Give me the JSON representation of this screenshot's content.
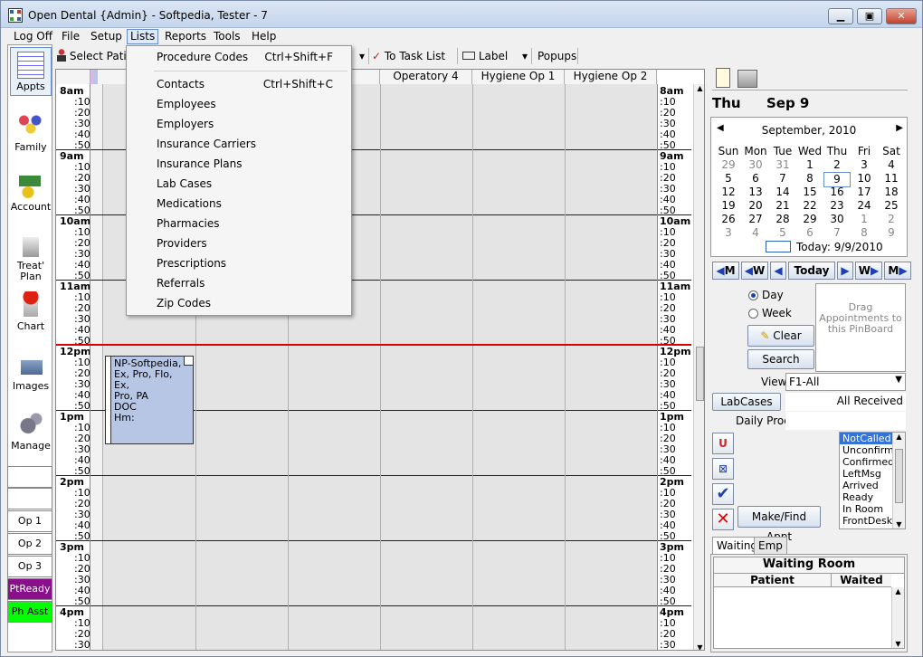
{
  "window": {
    "title": "Open Dental {Admin} - Softpedia, Tester - 7"
  },
  "menubar": {
    "items": [
      "Log Off",
      "File",
      "Setup",
      "Lists",
      "Reports",
      "Tools",
      "Help"
    ]
  },
  "toolbar": {
    "select_patient": "Select Pati",
    "task_list": "To Task List",
    "label": "Label",
    "popups": "Popups"
  },
  "nav": [
    {
      "label": "Appts",
      "icon": "appointments-icon"
    },
    {
      "label": "Family",
      "icon": "family-icon"
    },
    {
      "label": "Account",
      "icon": "account-icon"
    },
    {
      "label": "Treat' Plan",
      "icon": "treatment-plan-icon"
    },
    {
      "label": "Chart",
      "icon": "chart-tooth-icon"
    },
    {
      "label": "Images",
      "icon": "images-icon"
    },
    {
      "label": "Manage",
      "icon": "manage-gears-icon"
    }
  ],
  "providers": [
    "Op 1",
    "Op 2",
    "Op 3",
    "PtReady",
    "Ph Asst"
  ],
  "provider_colors": {
    "PtReady": "#8a0f8a",
    "Ph Asst": "#00ff00"
  },
  "operatories": [
    "y 3",
    "Operatory 4",
    "Hygiene Op 1",
    "Hygiene Op 2"
  ],
  "hours": [
    "8am",
    "9am",
    "10am",
    "11am",
    "12pm",
    "1pm",
    "2pm",
    "3pm",
    "4pm"
  ],
  "minutes": [
    ":10",
    ":20",
    ":30",
    ":40",
    ":50"
  ],
  "appointment": {
    "lines": [
      "NP-Softpedia,",
      "Ex, Pro, Flo, Ex,",
      "Pro, PA",
      "DOC",
      "Hm:"
    ]
  },
  "lists_menu": [
    {
      "label": "Procedure Codes",
      "shortcut": "Ctrl+Shift+F"
    },
    {
      "label": "Contacts",
      "shortcut": "Ctrl+Shift+C"
    },
    {
      "label": "Employees",
      "shortcut": ""
    },
    {
      "label": "Employers",
      "shortcut": ""
    },
    {
      "label": "Insurance Carriers",
      "shortcut": ""
    },
    {
      "label": "Insurance Plans",
      "shortcut": ""
    },
    {
      "label": "Lab Cases",
      "shortcut": ""
    },
    {
      "label": "Medications",
      "shortcut": ""
    },
    {
      "label": "Pharmacies",
      "shortcut": ""
    },
    {
      "label": "Providers",
      "shortcut": ""
    },
    {
      "label": "Prescriptions",
      "shortcut": ""
    },
    {
      "label": "Referrals",
      "shortcut": ""
    },
    {
      "label": "Zip Codes",
      "shortcut": ""
    }
  ],
  "date_header": {
    "day": "Thu",
    "date": "Sep 9"
  },
  "calendar": {
    "month": "September, 2010",
    "weekdays": [
      "Sun",
      "Mon",
      "Tue",
      "Wed",
      "Thu",
      "Fri",
      "Sat"
    ],
    "weeks": [
      [
        "29",
        "30",
        "31",
        "1",
        "2",
        "3",
        "4"
      ],
      [
        "5",
        "6",
        "7",
        "8",
        "9",
        "10",
        "11"
      ],
      [
        "12",
        "13",
        "14",
        "15",
        "16",
        "17",
        "18"
      ],
      [
        "19",
        "20",
        "21",
        "22",
        "23",
        "24",
        "25"
      ],
      [
        "26",
        "27",
        "28",
        "29",
        "30",
        "1",
        "2"
      ],
      [
        "3",
        "4",
        "5",
        "6",
        "7",
        "8",
        "9"
      ]
    ],
    "today": "Today: 9/9/2010"
  },
  "nav_buttons": {
    "month": "M",
    "week": "W",
    "today": "Today"
  },
  "view_mode": {
    "day": "Day",
    "week": "Week"
  },
  "pinboard": {
    "text": "Drag Appointments to this PinBoard"
  },
  "buttons": {
    "clear": "Clear",
    "search": "Search",
    "lab_cases": "LabCases",
    "make_find": "Make/Find Appt"
  },
  "view": {
    "label": "View",
    "value": "F1-All"
  },
  "lab_status": "All Received",
  "daily_prod": {
    "label": "Daily Prod",
    "value": ""
  },
  "status_list": [
    "NotCalled",
    "Unconfirmed",
    "Confirmed",
    "LeftMsg",
    "Arrived",
    "Ready",
    "In Room",
    "FrontDesk"
  ],
  "tabs": [
    "Waiting",
    "Emp"
  ],
  "waiting_room": {
    "title": "Waiting Room",
    "col_patient": "Patient",
    "col_waited": "Waited"
  }
}
